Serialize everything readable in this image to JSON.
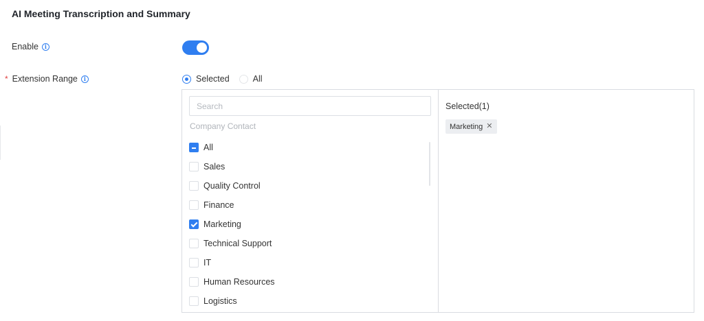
{
  "section": {
    "title": "AI Meeting Transcription and Summary"
  },
  "enable": {
    "label": "Enable",
    "icon": "info-icon",
    "on": true,
    "accent": "#2f7ef0"
  },
  "extension_range": {
    "required_mark": "*",
    "label": "Extension Range",
    "icon": "info-icon",
    "options": [
      {
        "label": "Selected",
        "checked": true
      },
      {
        "label": "All",
        "checked": false
      }
    ]
  },
  "transfer": {
    "search_placeholder": "Search",
    "search_value": "",
    "group_label": "Company Contact",
    "items": [
      {
        "label": "All",
        "state": "indeterminate"
      },
      {
        "label": "Sales",
        "state": "unchecked"
      },
      {
        "label": "Quality Control",
        "state": "unchecked"
      },
      {
        "label": "Finance",
        "state": "unchecked"
      },
      {
        "label": "Marketing",
        "state": "checked"
      },
      {
        "label": "Technical Support",
        "state": "unchecked"
      },
      {
        "label": "IT",
        "state": "unchecked"
      },
      {
        "label": "Human Resources",
        "state": "unchecked"
      },
      {
        "label": "Logistics",
        "state": "unchecked"
      }
    ],
    "selected_heading": "Selected(1)",
    "selected_tags": [
      {
        "label": "Marketing",
        "close_icon": "close-icon"
      }
    ]
  }
}
